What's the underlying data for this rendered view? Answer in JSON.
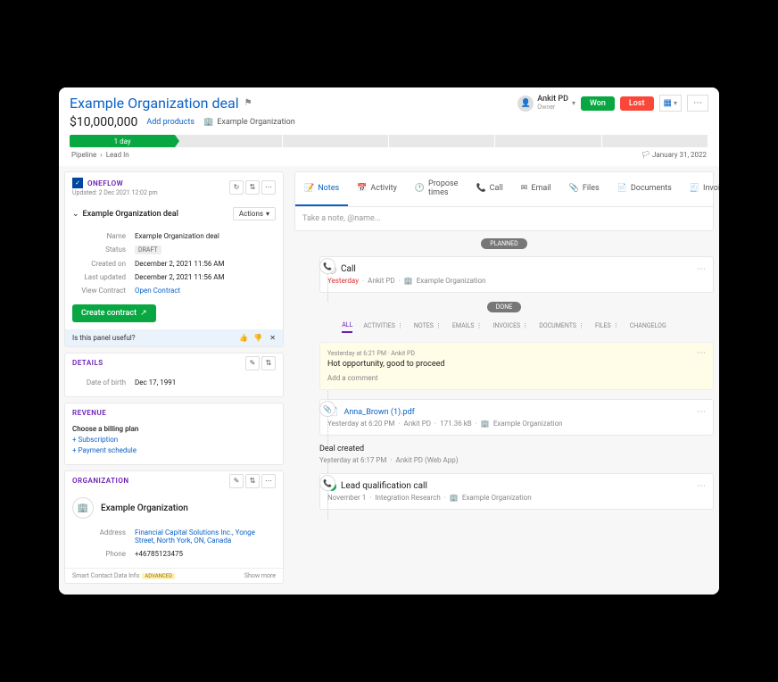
{
  "header": {
    "title": "Example Organization deal",
    "price": "$10,000,000",
    "add_products": "Add products",
    "org": "Example Organization",
    "owner_name": "Ankit PD",
    "owner_role": "Owner",
    "won": "Won",
    "lost": "Lost",
    "stage_label": "1 day",
    "crumb1": "Pipeline",
    "crumb2": "Lead In",
    "date": "January 31, 2022"
  },
  "oneflow": {
    "title": "ONEFLOW",
    "updated": "Updated: 2 Dec 2021 12:02 pm",
    "deal": "Example Organization deal",
    "actions": "Actions",
    "fields": {
      "name_l": "Name",
      "name_v": "Example Organization deal",
      "status_l": "Status",
      "status_v": "DRAFT",
      "created_l": "Created on",
      "created_v": "December 2, 2021 11:56 AM",
      "updated_l": "Last updated",
      "updated_v": "December 2, 2021 11:56 AM",
      "view_l": "View Contract",
      "view_v": "Open Contract"
    },
    "create": "Create contract",
    "useful": "Is this panel useful?"
  },
  "details": {
    "title": "DETAILS",
    "dob_l": "Date of birth",
    "dob_v": "Dec 17, 1991"
  },
  "revenue": {
    "title": "REVENUE",
    "choose": "Choose a billing plan",
    "sub": "+ Subscription",
    "pay": "+ Payment schedule"
  },
  "org": {
    "title": "ORGANIZATION",
    "name": "Example Organization",
    "addr_l": "Address",
    "addr_v": "Financial Capital Solutions Inc., Yonge Street, North York, ON, Canada",
    "phone_l": "Phone",
    "phone_v": "+46785123475",
    "smart": "Smart Contact Data Info",
    "adv": "ADVANCED",
    "more": "Show more"
  },
  "tabs": {
    "notes": "Notes",
    "activity": "Activity",
    "propose": "Propose times",
    "call": "Call",
    "email": "Email",
    "files": "Files",
    "documents": "Documents",
    "invoice": "Invoice",
    "placeholder": "Take a note, @name..."
  },
  "timeline": {
    "planned": "PLANNED",
    "done": "DONE",
    "call_title": "Call",
    "yesterday": "Yesterday",
    "ankit": "Ankit PD",
    "org": "Example Organization",
    "subtabs": {
      "all": "ALL",
      "activities": "ACTIVITIES",
      "notes": "NOTES",
      "emails": "EMAILS",
      "invoices": "INVOICES",
      "documents": "DOCUMENTS",
      "files": "FILES",
      "changelog": "CHANGELOG"
    },
    "note_time": "Yesterday at 6:21 PM",
    "note_text": "Hot opportunity, good to proceed",
    "add_comment": "Add a comment",
    "file_name": "Anna_Brown (1).pdf",
    "file_time": "Yesterday at 6:20 PM",
    "file_size": "171.36 kB",
    "deal_created": "Deal created",
    "deal_time": "Yesterday at 6:17 PM",
    "deal_by": "Ankit PD (Web App)",
    "lead_title": "Lead qualification call",
    "lead_date": "November 1",
    "lead_by": "Integration Research"
  }
}
